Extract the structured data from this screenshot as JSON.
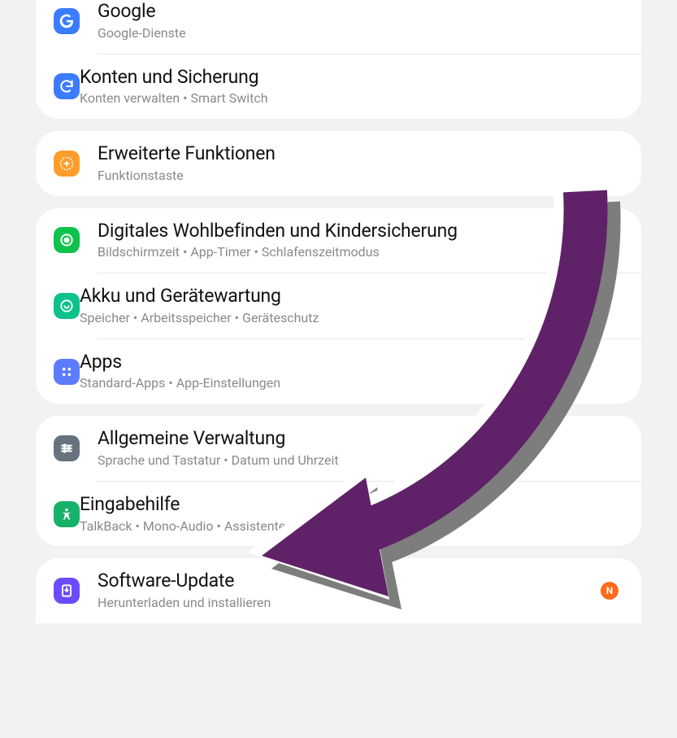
{
  "groups": [
    {
      "items": [
        {
          "id": "google",
          "title": "Google",
          "subtitle": "Google-Dienste",
          "icon": "google-icon",
          "iconBg": "bg-blue"
        },
        {
          "id": "accounts-backup",
          "title": "Konten und Sicherung",
          "subtitle": "Konten verwalten  •  Smart Switch",
          "icon": "sync-icon",
          "iconBg": "bg-blue"
        }
      ]
    },
    {
      "items": [
        {
          "id": "advanced-features",
          "title": "Erweiterte Funktionen",
          "subtitle": "Funktionstaste",
          "icon": "plus-gear-icon",
          "iconBg": "bg-orange"
        }
      ]
    },
    {
      "items": [
        {
          "id": "digital-wellbeing",
          "title": "Digitales Wohlbefinden und Kindersicherung",
          "subtitle": "Bildschirmzeit  •  App-Timer  •  Schlafenszeitmodus",
          "icon": "wellbeing-icon",
          "iconBg": "bg-green"
        },
        {
          "id": "battery-care",
          "title": "Akku und Gerätewartung",
          "subtitle": "Speicher  •  Arbeitsspeicher  •  Geräteschutz",
          "icon": "care-icon",
          "iconBg": "bg-teal"
        },
        {
          "id": "apps",
          "title": "Apps",
          "subtitle": "Standard-Apps  •  App-Einstellungen",
          "icon": "apps-icon",
          "iconBg": "bg-blue2"
        }
      ]
    },
    {
      "items": [
        {
          "id": "general-management",
          "title": "Allgemeine Verwaltung",
          "subtitle": "Sprache und Tastatur  •  Datum und Uhrzeit",
          "icon": "sliders-icon",
          "iconBg": "bg-gray"
        },
        {
          "id": "accessibility",
          "title": "Eingabehilfe",
          "subtitle": "TalkBack  •  Mono-Audio  •  Assistentenmenü",
          "icon": "accessibility-icon",
          "iconBg": "bg-green2"
        }
      ]
    },
    {
      "items": [
        {
          "id": "software-update",
          "title": "Software-Update",
          "subtitle": "Herunterladen und installieren",
          "icon": "download-icon",
          "iconBg": "bg-purple",
          "badge": "N"
        }
      ]
    }
  ],
  "arrow": {
    "color": "#5f2167",
    "shadow": "#7d7d7d"
  }
}
